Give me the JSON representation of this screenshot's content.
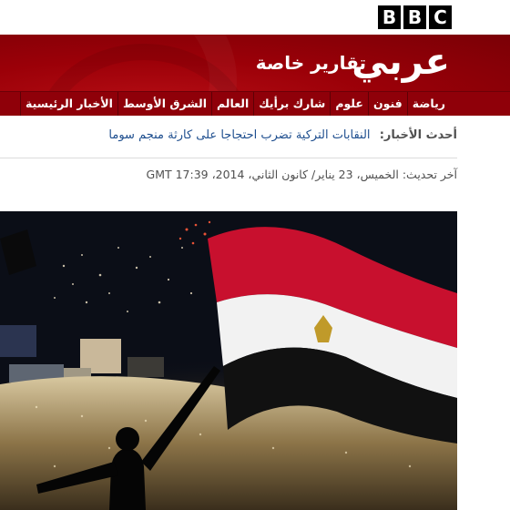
{
  "header": {
    "logo_letters": [
      "B",
      "B",
      "C"
    ],
    "brand": "عربي",
    "subtitle": "تقارير خاصة"
  },
  "nav": {
    "items": [
      "الأخبار الرئيسية",
      "الشرق الأوسط",
      "العالم",
      "شارك برأيك",
      "علوم",
      "فنون",
      "رياضة"
    ]
  },
  "latest": {
    "label": "أحدث الأخبار:",
    "headline": "النقابات التركية تضرب احتجاجا على كارثة منجم سوما"
  },
  "updated": {
    "text": "آخر تحديث: الخميس، 23 يناير/ كانون الثاني، 2014، GMT 17:39"
  },
  "hero": {
    "alt": "Crowd at night with fireworks and a waving Egyptian flag"
  },
  "colors": {
    "masthead_red": "#9b0008",
    "nav_red": "#8f0009",
    "link_blue": "#1f4f8f",
    "flag_red": "#c8102e",
    "flag_white": "#f2f2f2",
    "flag_black": "#111111",
    "eagle_gold": "#c09a2a"
  }
}
